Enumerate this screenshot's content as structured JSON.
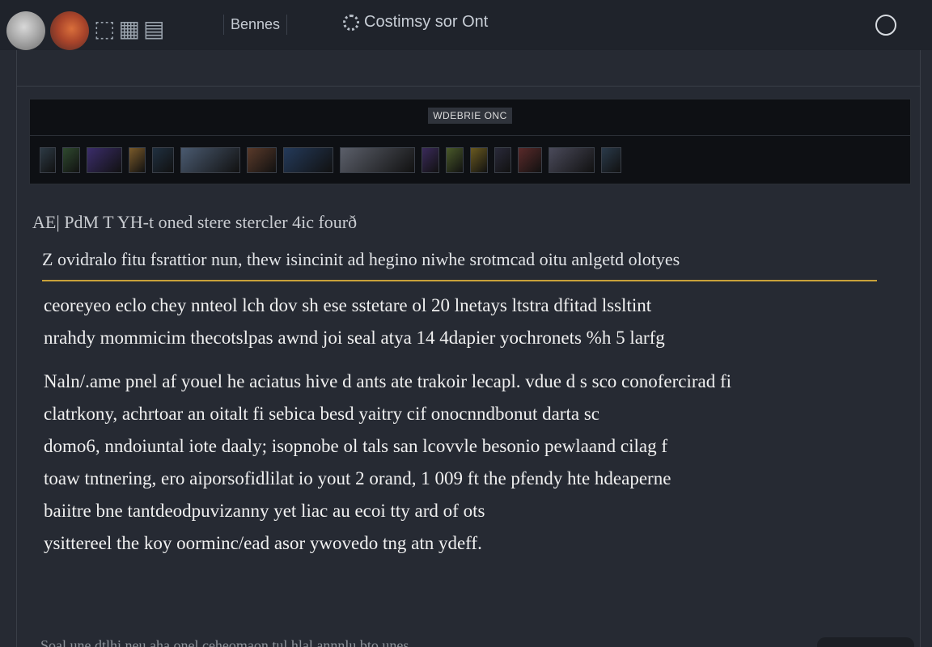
{
  "header": {
    "nav_tab": "Bennes",
    "settings_label": "Costimsy sor Ont",
    "icons": {
      "avatar1": "avatar",
      "avatar2": "avatar",
      "settings": "gear-icon",
      "chat": "chat-icon"
    }
  },
  "banner": {
    "title": "WDEBRIE ONC",
    "thumb_colors": [
      "#2d3a45",
      "#2f4a2f",
      "#3b2d6b",
      "#7a5a2a",
      "#203040",
      "#4a5a70",
      "#5a3a2a",
      "#243a5a",
      "#5b5f6a",
      "#3a2a5a",
      "#4a5a2a",
      "#6a5a20",
      "#2a2a3a",
      "#5a2a2a",
      "#4a4a5a",
      "#2a3a4a"
    ]
  },
  "article": {
    "heading": "AE| PdM T YH-t oned stere stercler 4ic fourð",
    "subheading": "Z ovidralo fitu fsrattior nun, thew isincinit ad hegino niwhe srotmcad oitu anlgetd olotyes",
    "paragraph1": [
      "ceoreyeo eclo chey nnteol lch dov sh ese sstetare ol 20 lnetays ltstra dfitad lssltint",
      "nrahdy mommicim thecotslpas awnd joi seal atya 14 4dapier yochronets %h 5 larfg"
    ],
    "paragraph2": [
      "Naln/.ame pnel af youel he aciatus hive d ants ate trakoir lecapl. vdue d s sco conofercirad fi",
      "clatrkony, achrtoar an oitalt fi sebica besd yaitry cif onocnndbonut darta sc",
      "domo6, nndoiuntal iote daaly; isopnobe ol tals san lcovvle besonio pewlaand cilag f",
      "toaw tntnering, ero aiporsofidlilat io yout 2 orand, 1 009 ft the pfendy hte hdeaperne",
      "baiitre bne tantdeodpuvizanny yet liac au ecoi tty ard of ots",
      "ysittereel the koy oorminc/ead asor ywovedo tng atn ydeff."
    ],
    "footer_text": "Soal une dtlhi neu aha onel ceheomaon tul hlal annnlu bto unes"
  }
}
